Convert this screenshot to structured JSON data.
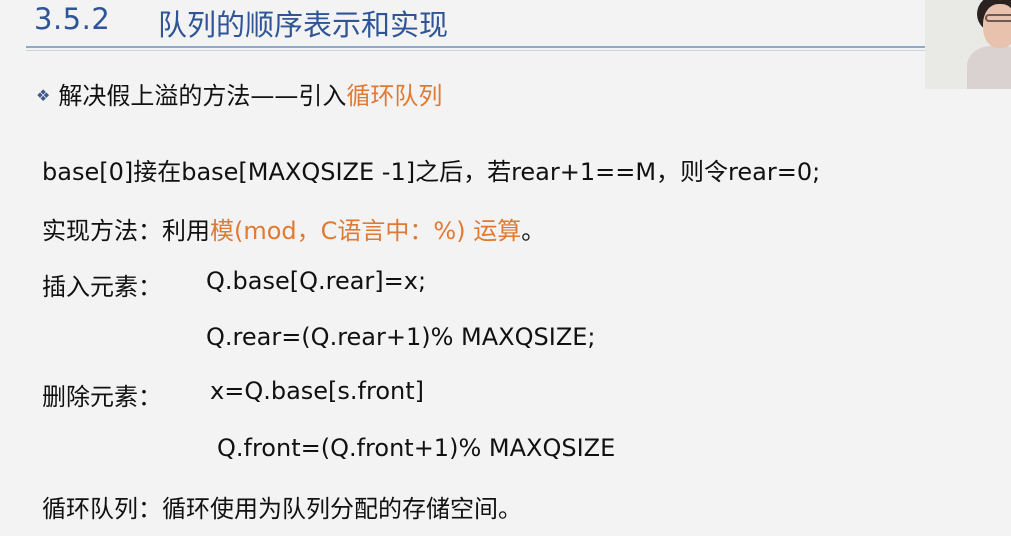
{
  "title": {
    "number": "3.5.2",
    "text": "队列的顺序表示和实现"
  },
  "bullet": {
    "icon": "diamond-bullet-icon",
    "symbol": "❖",
    "lead": "解决假上溢的方法——引入",
    "highlight": "循环队列"
  },
  "lines": {
    "line1": "base[0]接在base[MAXQSIZE -1]之后，若rear+1==M，则令rear=0;",
    "line2_lead": "实现方法：利用",
    "line2_highlight": "模(mod，C语言中：%) 运算",
    "line2_tail": "。",
    "insert_label": "插入元素：",
    "insert_code1": "Q.base[Q.rear]=x;",
    "insert_code2": "Q.rear=(Q.rear+1)% MAXQSIZE;",
    "delete_label": "删除元素：",
    "delete_code1": "x=Q.base[s.front]",
    "delete_code2": "Q.front=(Q.front+1)% MAXQSIZE",
    "summary": "循环队列：循环使用为队列分配的存储空间。"
  },
  "colors": {
    "title": "#2f5597",
    "accent": "#e07a32",
    "text": "#111111",
    "background": "#f3f3f3"
  }
}
